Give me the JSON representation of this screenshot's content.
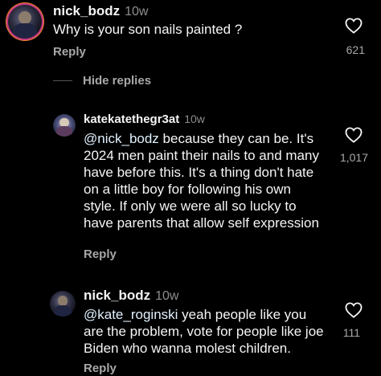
{
  "comments": [
    {
      "username": "nick_bodz",
      "time": "10w",
      "text": "Why is your son nails painted ?",
      "reply_label": "Reply",
      "likes": "621"
    },
    {
      "username": "katekatethegr3at",
      "time": "10w",
      "mention": "@nick_bodz",
      "text": " because they can be. It's 2024 men paint their nails to and many have before this. It's a thing don't hate on a little boy for following his own style. If only we were all so lucky to have parents that allow self expression",
      "reply_label": "Reply",
      "likes": "1,017"
    },
    {
      "username": "nick_bodz",
      "time": "10w",
      "mention": "@kate_roginski",
      "text": " yeah people like you are the problem, vote for people like joe Biden who wanna molest children.",
      "reply_label": "Reply",
      "likes": "111"
    }
  ],
  "hide_replies_label": "Hide replies",
  "icons": {
    "like": "heart-outline-icon"
  },
  "colors": {
    "background": "#000000",
    "text": "#f5f5f5",
    "muted": "#a8a8a8"
  }
}
